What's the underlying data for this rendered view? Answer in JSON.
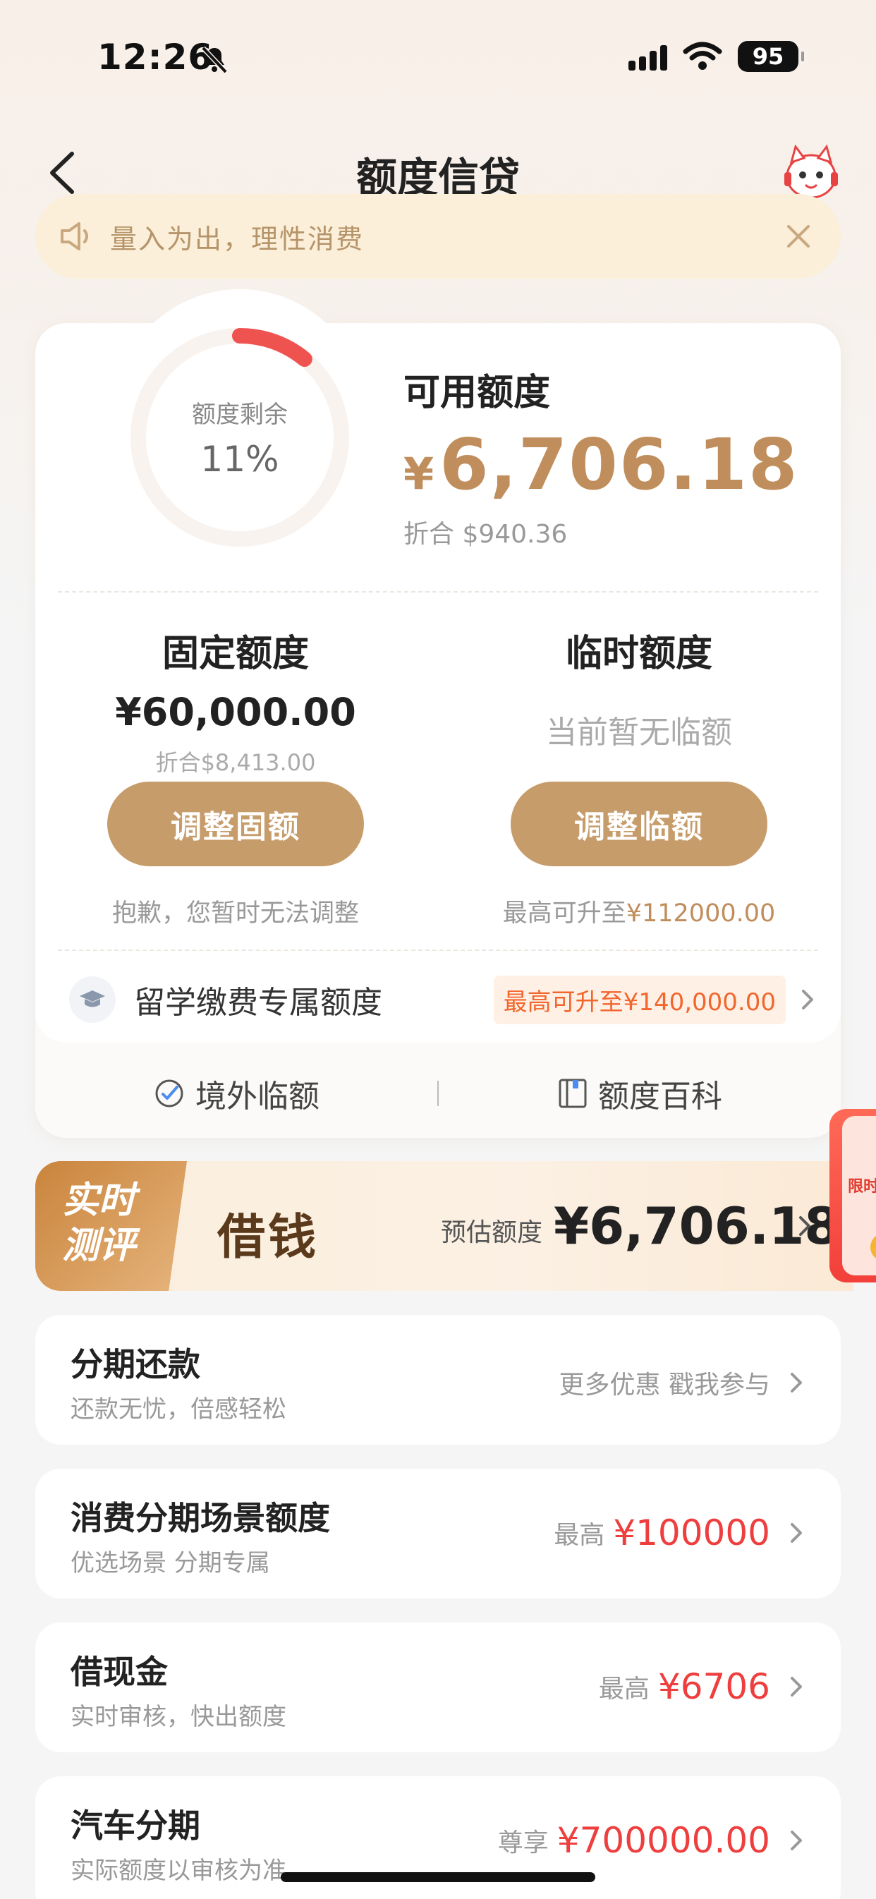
{
  "status_bar": {
    "time": "12:26",
    "battery": "95"
  },
  "header": {
    "title": "额度信贷"
  },
  "notice": {
    "text": "量入为出，理性消费"
  },
  "credit": {
    "remaining_label": "额度剩余",
    "remaining_percent": "11%",
    "remaining_fraction": 0.11,
    "available_label": "可用额度",
    "available_currency": "¥",
    "available_amount": "6,706.18",
    "available_converted": "折合 $940.36"
  },
  "fixed": {
    "title": "固定额度",
    "amount": "¥60,000.00",
    "converted": "折合$8,413.00",
    "button": "调整固额",
    "note": "抱歉，您暂时无法调整"
  },
  "temporary": {
    "title": "临时额度",
    "empty_text": "当前暂无临额",
    "button": "调整临额",
    "note_prefix": "最高可升至",
    "note_amount": "¥112000.00"
  },
  "study_abroad": {
    "label": "留学缴费专属额度",
    "badge": "最高可升至¥140,000.00"
  },
  "extra_links": [
    {
      "label": "境外临额",
      "icon": "overseas-icon"
    },
    {
      "label": "额度百科",
      "icon": "book-icon"
    }
  ],
  "borrow": {
    "tag": "实时测评",
    "tag_line1": "实时",
    "tag_line2": "测评",
    "title": "借钱",
    "estimate_label": "预估额度",
    "estimate_amount": "¥6,706.18"
  },
  "promo": {
    "text": "限时"
  },
  "list": [
    {
      "title": "分期还款",
      "subtitle": "还款无忧，倍感轻松",
      "right_text": "更多优惠 戳我参与",
      "highlight": ""
    },
    {
      "title": "消费分期场景额度",
      "subtitle": "优选场景 分期专属",
      "right_text": "最高",
      "highlight": "¥100000"
    },
    {
      "title": "借现金",
      "subtitle": "实时审核，快出额度",
      "right_text": "最高",
      "highlight": "¥6706"
    },
    {
      "title": "汽车分期",
      "subtitle": "实际额度以审核为准",
      "right_text": "尊享",
      "highlight": "¥700000.00"
    }
  ],
  "colors": {
    "accent": "#c08e5c",
    "button": "#c79c6b",
    "red": "#ee3e3e",
    "gauge_arc": "#ef5350"
  }
}
